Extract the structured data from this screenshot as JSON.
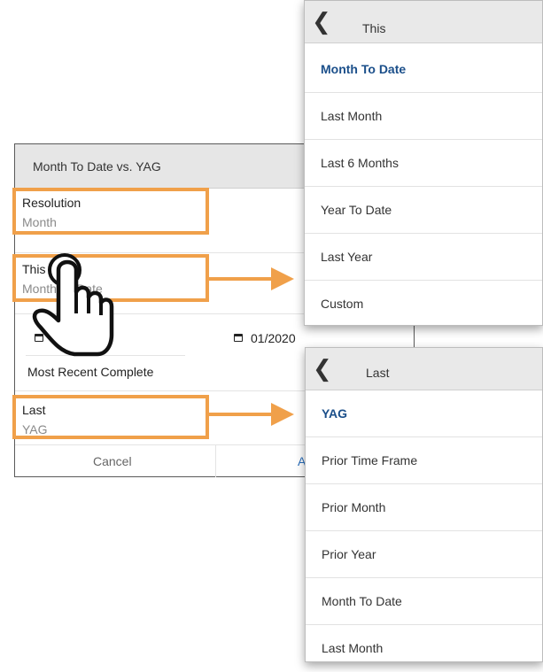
{
  "dialog": {
    "title": "Month To Date vs. YAG",
    "resolution": {
      "label": "Resolution",
      "value": "Month"
    },
    "this": {
      "label": "This",
      "value": "Month To Date"
    },
    "date_range": {
      "start": "",
      "end": "01/2020"
    },
    "most_recent": "Most Recent Complete",
    "last": {
      "label": "Last",
      "value": "YAG"
    },
    "cancel_label": "Cancel",
    "apply_label": "A"
  },
  "this_panel": {
    "back_icon": "chevron-left-icon",
    "title": "This",
    "options": [
      "Month To Date",
      "Last Month",
      "Last 6 Months",
      "Year To Date",
      "Last Year",
      "Custom"
    ],
    "selected": "Month To Date"
  },
  "last_panel": {
    "back_icon": "chevron-left-icon",
    "title": "Last",
    "options": [
      "YAG",
      "Prior Time Frame",
      "Prior Month",
      "Prior Year",
      "Month To Date",
      "Last Month"
    ],
    "selected": "YAG"
  },
  "colors": {
    "highlight": "#f0a04a",
    "selected_text": "#1b4f8a",
    "header_bg": "#e6e6e6"
  },
  "icons": [
    "calendar-icon",
    "hand-pointer-icon",
    "chevron-left-icon",
    "arrow-right-icon"
  ]
}
